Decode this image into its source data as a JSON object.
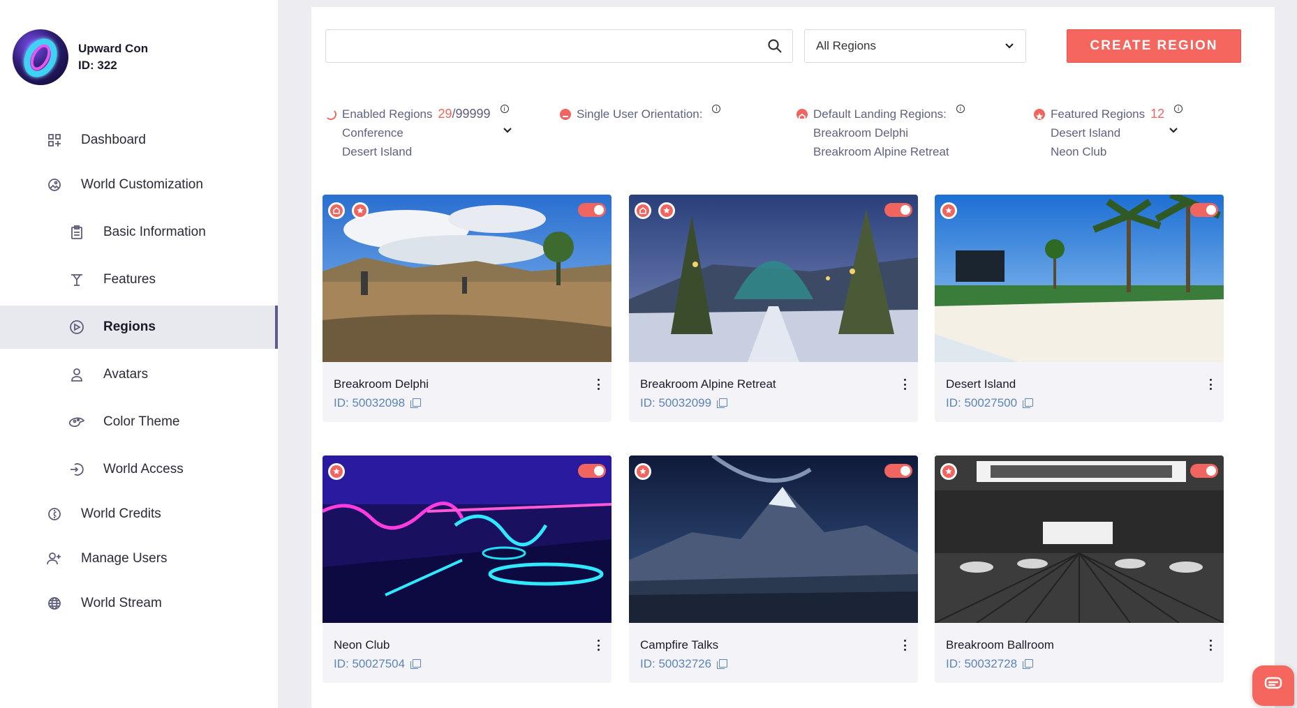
{
  "profile": {
    "name": "Upward Con",
    "id_label": "ID: 322"
  },
  "nav": [
    {
      "label": "Dashboard",
      "icon": "dashboard-icon"
    },
    {
      "label": "World Customization",
      "icon": "image-icon"
    },
    {
      "label": "Basic Information",
      "icon": "clipboard-icon"
    },
    {
      "label": "Features",
      "icon": "features-icon"
    },
    {
      "label": "Regions",
      "icon": "regions-icon",
      "active": true
    },
    {
      "label": "Avatars",
      "icon": "user-icon"
    },
    {
      "label": "Color Theme",
      "icon": "palette-icon"
    },
    {
      "label": "World Access",
      "icon": "sign-in-icon"
    },
    {
      "label": "World Credits",
      "icon": "credits-icon"
    },
    {
      "label": "Manage Users",
      "icon": "add-user-icon"
    },
    {
      "label": "World Stream",
      "icon": "globe-icon"
    }
  ],
  "toolbar": {
    "search_placeholder": "",
    "region_filter": "All Regions",
    "create_label": "CREATE REGION"
  },
  "stats": {
    "enabled": {
      "label": "Enabled Regions",
      "count": "29",
      "total": "/99999",
      "items": [
        "Conference",
        "Desert Island"
      ]
    },
    "orientation": {
      "label": "Single User Orientation:"
    },
    "landing": {
      "label": "Default Landing Regions:",
      "items": [
        "Breakroom Delphi",
        "Breakroom Alpine Retreat"
      ]
    },
    "featured": {
      "label": "Featured Regions",
      "count": "12",
      "items": [
        "Desert Island",
        "Neon Club"
      ]
    }
  },
  "regions": [
    {
      "name": "Breakroom Delphi",
      "id": "ID: 50032098",
      "home": true,
      "featured": true,
      "enabled": true
    },
    {
      "name": "Breakroom Alpine Retreat",
      "id": "ID: 50032099",
      "home": true,
      "featured": true,
      "enabled": true
    },
    {
      "name": "Desert Island",
      "id": "ID: 50027500",
      "home": false,
      "featured": true,
      "enabled": true
    },
    {
      "name": "Neon Club",
      "id": "ID: 50027504",
      "home": false,
      "featured": true,
      "enabled": true
    },
    {
      "name": "Campfire Talks",
      "id": "ID: 50032726",
      "home": false,
      "featured": true,
      "enabled": true
    },
    {
      "name": "Breakroom Ballroom",
      "id": "ID: 50032728",
      "home": false,
      "featured": true,
      "enabled": true
    }
  ],
  "colors": {
    "accent": "#f4665e",
    "link": "#5b84b8",
    "active_bar": "#5a5d8a"
  }
}
